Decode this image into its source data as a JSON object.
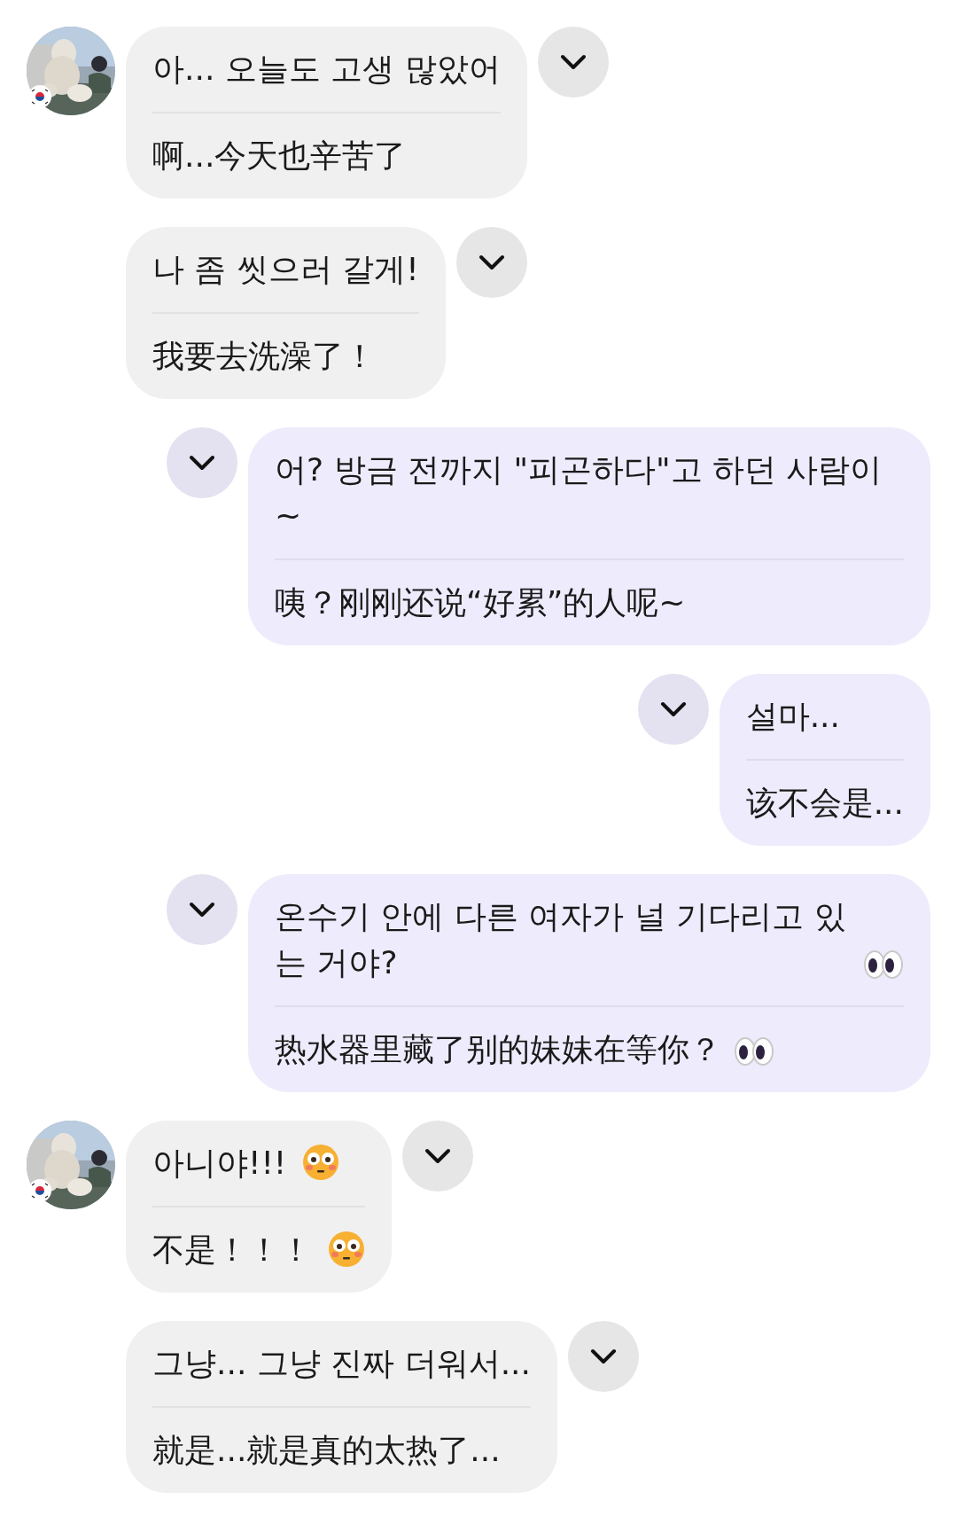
{
  "messages": [
    {
      "kind": "incoming",
      "show_avatar": true,
      "lines": [
        {
          "kind": "plain",
          "text": "아... 오늘도 고생 많았어"
        },
        {
          "kind": "plain",
          "text": "啊...今天也辛苦了"
        }
      ]
    },
    {
      "kind": "incoming",
      "show_avatar": false,
      "lines": [
        {
          "kind": "plain",
          "text": "나 좀 씻으러 갈게!"
        },
        {
          "kind": "plain",
          "text": "我要去洗澡了！"
        }
      ]
    },
    {
      "kind": "outgoing",
      "lines": [
        {
          "kind": "plain",
          "text": "어? 방금 전까지 \"피곤하다\"고 하던 사람이~"
        },
        {
          "kind": "plain",
          "text": "咦？刚刚还说“好累”的人呢~"
        }
      ]
    },
    {
      "kind": "outgoing",
      "lines": [
        {
          "kind": "plain",
          "text": "설마..."
        },
        {
          "kind": "plain",
          "text": "该不会是..."
        }
      ]
    },
    {
      "kind": "outgoing",
      "lines": [
        {
          "kind": "eyes",
          "text": "온수기 안에 다른 여자가 널 기다리고 있는 거야?"
        },
        {
          "kind": "eyes",
          "text": "热水器里藏了别的妹妹在等你？"
        }
      ]
    },
    {
      "kind": "incoming",
      "show_avatar": true,
      "lines": [
        {
          "kind": "flushed",
          "text": "아니야!!!"
        },
        {
          "kind": "flushed",
          "text": "不是！！！"
        }
      ]
    },
    {
      "kind": "incoming",
      "show_avatar": false,
      "lines": [
        {
          "kind": "plain",
          "text": "그냥... 그냥 진짜 더워서..."
        },
        {
          "kind": "plain",
          "text": "就是...就是真的太热了..."
        }
      ]
    }
  ]
}
